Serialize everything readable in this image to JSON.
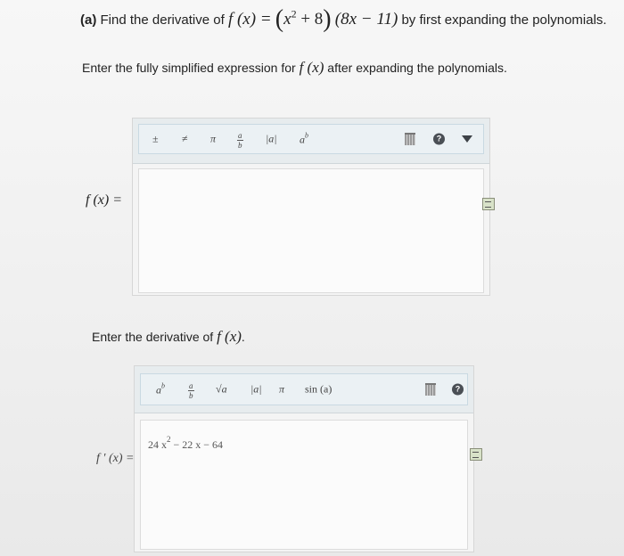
{
  "question": {
    "label": "(a)",
    "text_before": "Find the derivative of",
    "fx": "f (x) =",
    "poly1_open": "(",
    "poly1": "x",
    "poly1_exp": "2",
    "poly1_rest": "+ 8",
    "poly1_close": ")",
    "poly2": "(8x − 11)",
    "text_after": "by first expanding the polynomials."
  },
  "instruction1": {
    "before": "Enter the fully simplified expression for",
    "fx": "f (x)",
    "after": "after expanding the polynomials."
  },
  "editor1": {
    "label": "f (x) =",
    "tools": {
      "plus_minus": "±",
      "not_equal": "≠",
      "pi": "π",
      "frac_num": "a",
      "frac_den": "b",
      "abs": "|a|",
      "power_base": "a",
      "power_exp": "b"
    },
    "answer": ""
  },
  "instruction2": {
    "before": "Enter the derivative of",
    "fx": "f (x)",
    "after": "."
  },
  "editor2": {
    "label": "f ′ (x) =",
    "tools": {
      "power_base": "a",
      "power_exp": "b",
      "frac_num": "a",
      "frac_den": "b",
      "sqrt": "√a",
      "abs": "|a|",
      "pi": "π",
      "sin": "sin (a)"
    },
    "answer_coef": "24 x",
    "answer_exp": "2",
    "answer_rest": "− 22 x − 64"
  },
  "colors": {
    "toolbar": "#e7ecee",
    "help": "#4a4f55"
  }
}
